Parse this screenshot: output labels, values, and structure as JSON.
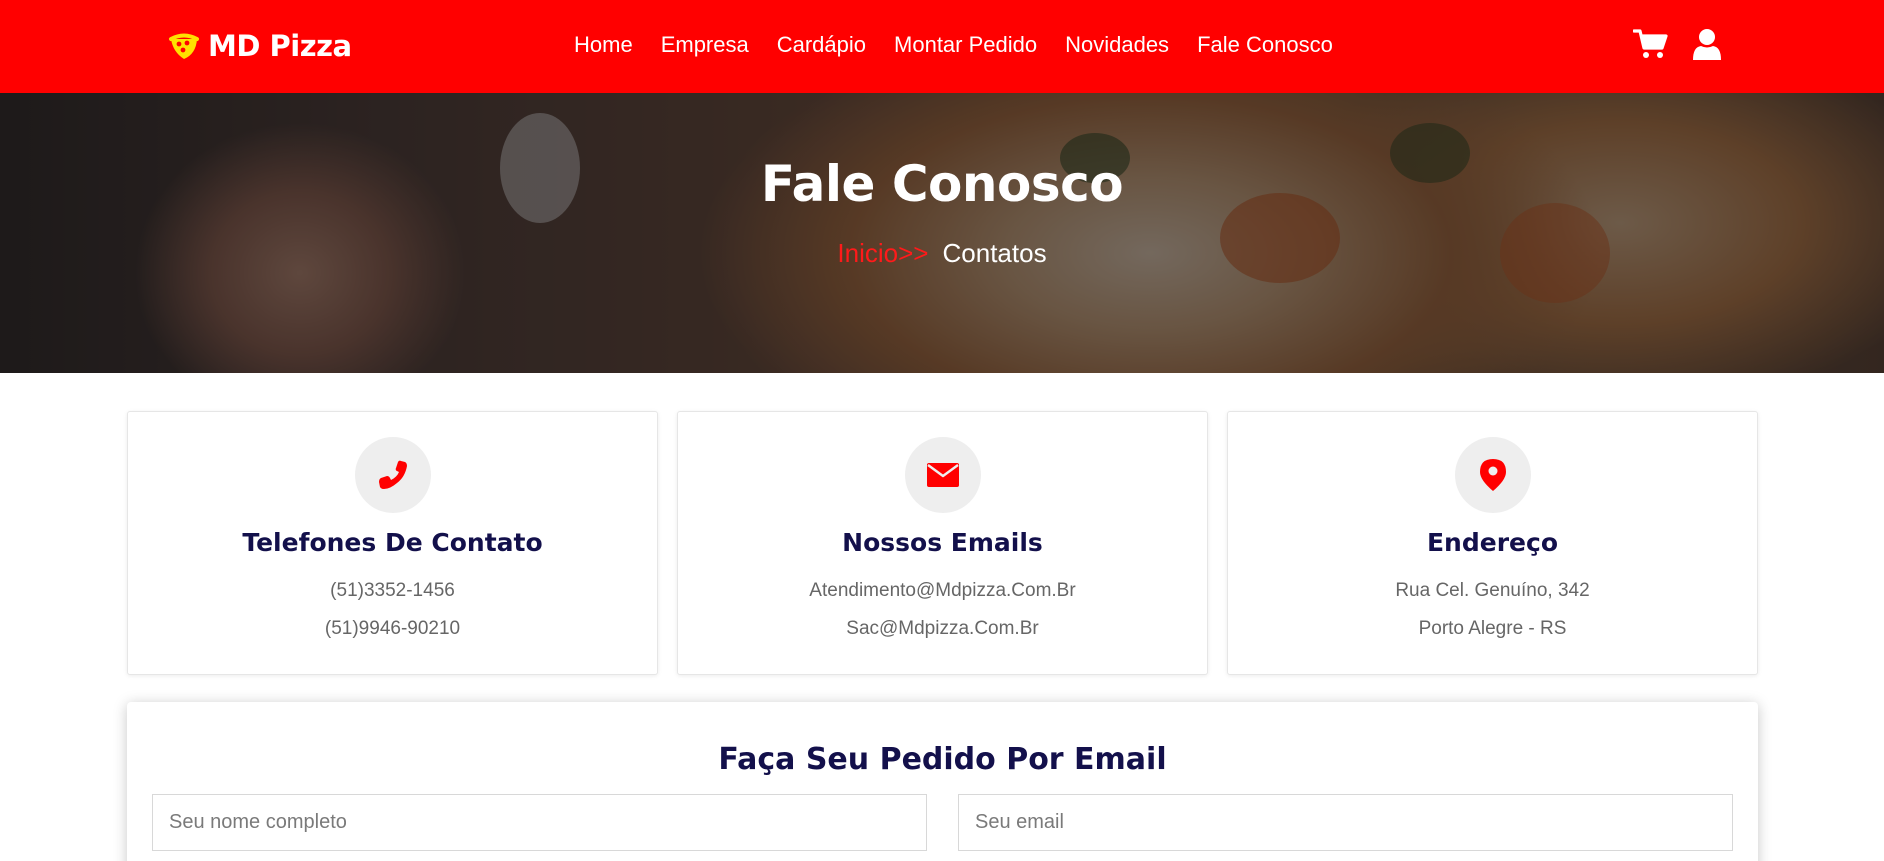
{
  "brand": {
    "name": "MD Pizza",
    "icon": "pizza-slice-icon"
  },
  "nav": {
    "links": [
      {
        "label": "Home"
      },
      {
        "label": "Empresa"
      },
      {
        "label": "Cardápio"
      },
      {
        "label": "Montar Pedido"
      },
      {
        "label": "Novidades"
      },
      {
        "label": "Fale Conosco"
      }
    ],
    "icons": [
      "cart-icon",
      "user-icon"
    ]
  },
  "hero": {
    "title": "Fale Conosco",
    "breadcrumb": {
      "home": "Inicio",
      "separator": ">>",
      "current": "Contatos"
    }
  },
  "cards": [
    {
      "icon": "phone-icon",
      "title": "Telefones De Contato",
      "lines": [
        "(51)3352-1456",
        "(51)9946-90210"
      ]
    },
    {
      "icon": "envelope-icon",
      "title": "Nossos Emails",
      "lines": [
        "Atendimento@Mdpizza.Com.Br",
        "Sac@Mdpizza.Com.Br"
      ]
    },
    {
      "icon": "map-pin-icon",
      "title": "Endereço",
      "lines": [
        "Rua Cel. Genuíno, 342",
        "Porto Alegre - RS"
      ]
    }
  ],
  "form": {
    "title": "Faça Seu Pedido Por Email",
    "name_placeholder": "Seu nome completo",
    "email_placeholder": "Seu email",
    "name_value": "",
    "email_value": ""
  },
  "colors": {
    "primary": "#ff0000",
    "heading": "#13104b",
    "muted": "#666666",
    "brand_icon": "#ffe000"
  }
}
